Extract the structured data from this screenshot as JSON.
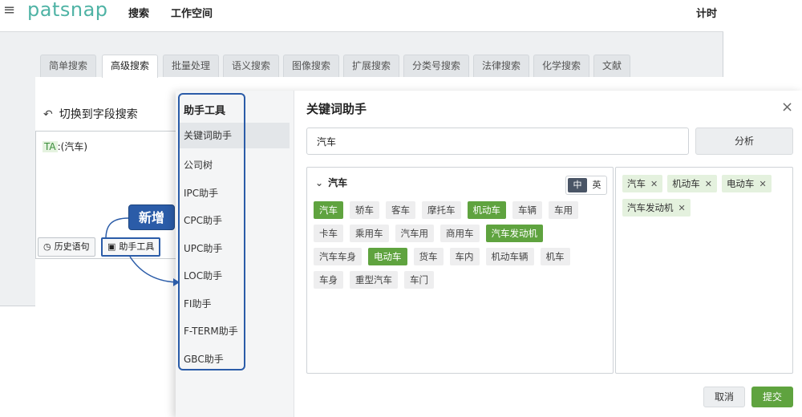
{
  "app": {
    "logo": "patsnap",
    "nav": {
      "search": "搜索",
      "workspace": "工作空间",
      "timer": "计时"
    },
    "tabs": [
      "简单搜索",
      "高级搜索",
      "批量处理",
      "语义搜索",
      "图像搜索",
      "扩展搜索",
      "分类号搜索",
      "法律搜索",
      "化学搜索",
      "文献"
    ],
    "active_tab": "高级搜索",
    "switch_link": "切换到字段搜索",
    "query": {
      "field": "TA",
      "value": ":(汽车)"
    },
    "history_button": "历史语句",
    "helper_button": "助手工具",
    "new_badge": "新增"
  },
  "modal": {
    "sidebar": {
      "title": "助手工具",
      "items": [
        "关键词助手",
        "公司树",
        "IPC助手",
        "CPC助手",
        "UPC助手",
        "LOC助手",
        "FI助手",
        "F-TERM助手",
        "GBC助手"
      ],
      "selected": "关键词助手"
    },
    "title": "关键词助手",
    "close": "×",
    "input_value": "汽车",
    "analyze_button": "分析",
    "group_label": "汽车",
    "lang_zh": "中",
    "lang_en": "英",
    "keyword_rows": [
      [
        {
          "t": "汽车",
          "on": true
        },
        {
          "t": "轿车",
          "on": false
        },
        {
          "t": "客车",
          "on": false
        },
        {
          "t": "摩托车",
          "on": false
        },
        {
          "t": "机动车",
          "on": true
        },
        {
          "t": "车辆",
          "on": false
        },
        {
          "t": "车用",
          "on": false
        }
      ],
      [
        {
          "t": "卡车",
          "on": false
        },
        {
          "t": "乘用车",
          "on": false
        },
        {
          "t": "汽车用",
          "on": false
        },
        {
          "t": "商用车",
          "on": false
        },
        {
          "t": "汽车发动机",
          "on": true
        }
      ],
      [
        {
          "t": "汽车车身",
          "on": false
        },
        {
          "t": "电动车",
          "on": true
        },
        {
          "t": "货车",
          "on": false
        },
        {
          "t": "车内",
          "on": false
        },
        {
          "t": "机动车辆",
          "on": false
        },
        {
          "t": "机车",
          "on": false
        }
      ],
      [
        {
          "t": "车身",
          "on": false
        },
        {
          "t": "重型汽车",
          "on": false
        },
        {
          "t": "车门",
          "on": false
        }
      ]
    ],
    "selected_keywords": [
      [
        "汽车",
        "机动车",
        "电动车"
      ],
      [
        "汽车发动机"
      ]
    ],
    "cancel_button": "取消",
    "submit_button": "提交"
  },
  "colors": {
    "brand": "#4fb3a5",
    "accent_blue": "#2b5ca8",
    "green": "#5fa33f",
    "selected_bg": "#e4f1de"
  },
  "icons": {
    "menu": "hamburger-icon",
    "switch": "undo-arrow-icon",
    "history": "clock-icon",
    "helper": "toolbox-icon",
    "group": "chevron-down-icon",
    "close": "close-icon",
    "remove": "remove-x-icon"
  }
}
